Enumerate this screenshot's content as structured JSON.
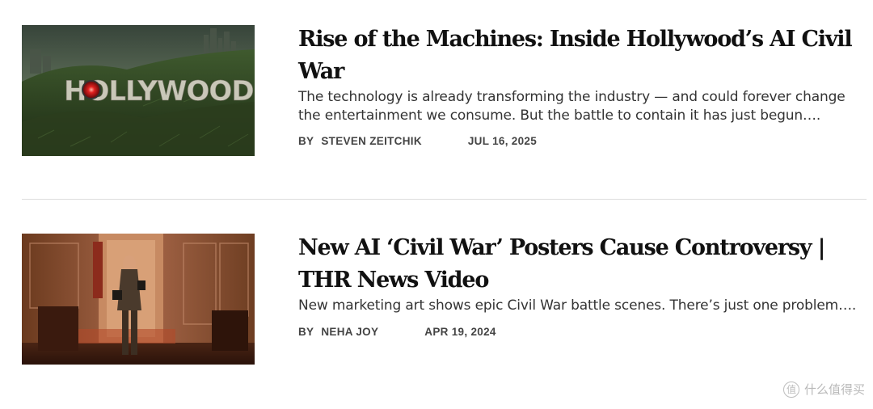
{
  "articles": [
    {
      "headline": "Rise of the Machines: Inside Hollywood’s AI Civil War",
      "dek": "The technology is already transforming the industry — and could forever change the entertainment we consume. But the battle to contain it has just begun….",
      "by_label": "BY",
      "author": "STEVEN ZEITCHIK",
      "date": "JUL 16, 2025",
      "image": {
        "sign_text": "HOLLYWOOD",
        "sign_color": "#c9c7b8",
        "sign_eye_color": "#d41c1c"
      }
    },
    {
      "headline": "New AI ‘Civil War’ Posters Cause Controversy | THR News Video",
      "dek": "New marketing art shows epic Civil War battle scenes. There’s just one problem….",
      "by_label": "BY",
      "author": "NEHA JOY",
      "date": "APR 19, 2024"
    }
  ],
  "watermark": {
    "text": "什么值得买",
    "icon": "值"
  },
  "colors": {
    "headline": "#111111",
    "dek": "#333333",
    "meta": "#444444",
    "divider": "#dddddd"
  }
}
